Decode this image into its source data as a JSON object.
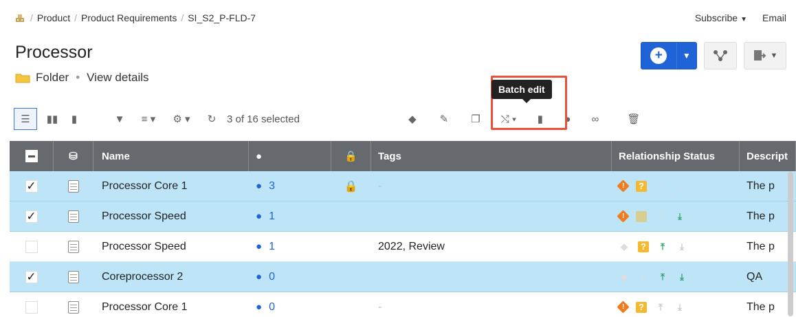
{
  "breadcrumb": [
    "Product",
    "Product Requirements",
    "SI_S2_P-FLD-7"
  ],
  "top_right": {
    "subscribe": "Subscribe",
    "email": "Email"
  },
  "page": {
    "title": "Processor",
    "type": "Folder",
    "view_details": "View details"
  },
  "tooltip": "Batch edit",
  "toolbar": {
    "selected": "3 of 16 selected"
  },
  "table": {
    "columns": [
      "Name",
      "Tags",
      "Relationship Status",
      "Descript"
    ],
    "rows": [
      {
        "name": "Processor Core 1",
        "comments": "3",
        "tags": "-",
        "desc": "The p"
      },
      {
        "name": "Processor Speed",
        "comments": "1",
        "tags": "",
        "desc": "The p"
      },
      {
        "name": "Processor Speed",
        "comments": "1",
        "tags": "2022, Review",
        "desc": "The p"
      },
      {
        "name": "Coreprocessor 2",
        "comments": "0",
        "tags": "",
        "desc": "QA"
      },
      {
        "name": "Processor Core 1",
        "comments": "0",
        "tags": "-",
        "desc": "The p"
      }
    ]
  },
  "colors": {
    "accent": "#1f63d6",
    "selected_row": "#bde4f7",
    "header": "#666a6f",
    "highlight": "#e8503a"
  }
}
